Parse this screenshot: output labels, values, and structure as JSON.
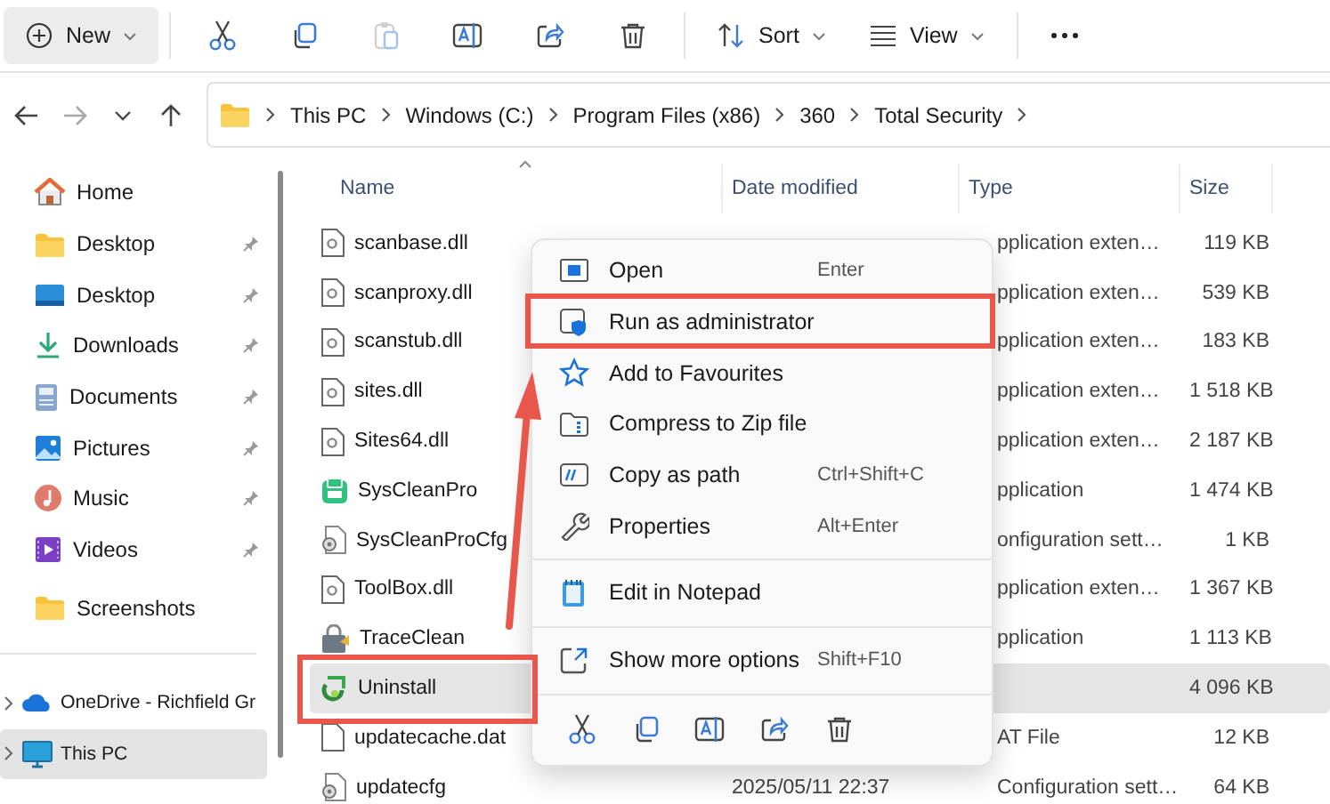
{
  "toolbar": {
    "groups": [
      [
        {
          "kind": "new",
          "label": "New",
          "selected": true,
          "disabled": false
        }
      ],
      [
        {
          "kind": "cut",
          "selected": false,
          "disabled": false
        },
        {
          "kind": "copy",
          "selected": false,
          "disabled": false
        },
        {
          "kind": "paste",
          "selected": false,
          "disabled": true
        },
        {
          "kind": "rename",
          "selected": false,
          "disabled": false
        },
        {
          "kind": "share",
          "selected": false,
          "disabled": false
        },
        {
          "kind": "delete",
          "selected": false,
          "disabled": false
        }
      ],
      [
        {
          "kind": "sort",
          "label": "Sort",
          "selected": false,
          "disabled": false
        },
        {
          "kind": "view",
          "label": "View",
          "selected": false,
          "disabled": false
        }
      ],
      [
        {
          "kind": "more",
          "selected": false,
          "disabled": false
        }
      ]
    ]
  },
  "navigation": {
    "forward_disabled": true
  },
  "address_bar": {
    "path": [
      "This PC",
      "Windows (C:)",
      "Program Files (x86)",
      "360",
      "Total Security"
    ]
  },
  "sidebar": {
    "items": [
      {
        "kind": "home",
        "label": "Home",
        "pinned": false
      },
      {
        "kind": "folder",
        "label": "Desktop",
        "pinned": true
      },
      {
        "kind": "desktop",
        "label": "Desktop",
        "pinned": true
      },
      {
        "kind": "downloads",
        "label": "Downloads",
        "pinned": true
      },
      {
        "kind": "documents",
        "label": "Documents",
        "pinned": true
      },
      {
        "kind": "pictures",
        "label": "Pictures",
        "pinned": true
      },
      {
        "kind": "music",
        "label": "Music",
        "pinned": true
      },
      {
        "kind": "videos",
        "label": "Videos",
        "pinned": true
      },
      {
        "kind": "folder",
        "label": "Screenshots",
        "pinned": false
      }
    ],
    "drives": [
      {
        "kind": "cloud",
        "label": "OneDrive - Richfield Gr",
        "expanded": false,
        "selected": false
      },
      {
        "kind": "pc",
        "label": "This PC",
        "expanded": false,
        "selected": true
      }
    ]
  },
  "file_list": {
    "columns": [
      "Name",
      "Date modified",
      "Type",
      "Size"
    ],
    "rows": [
      {
        "kind": "dll",
        "name": "scanbase.dll",
        "type": "pplication exten…",
        "size": "119 KB",
        "selected": false
      },
      {
        "kind": "dll",
        "name": "scanproxy.dll",
        "type": "pplication exten…",
        "size": "539 KB",
        "selected": false
      },
      {
        "kind": "dll",
        "name": "scanstub.dll",
        "type": "pplication exten…",
        "size": "183 KB",
        "selected": false
      },
      {
        "kind": "dll",
        "name": "sites.dll",
        "type": "pplication exten…",
        "size": "1 518 KB",
        "selected": false
      },
      {
        "kind": "dll",
        "name": "Sites64.dll",
        "type": "pplication exten…",
        "size": "2 187 KB",
        "selected": false
      },
      {
        "kind": "app",
        "name": "SysCleanPro",
        "type": "pplication",
        "size": "1 474 KB",
        "selected": false
      },
      {
        "kind": "config",
        "name": "SysCleanProCfg",
        "type": "onfiguration sett…",
        "size": "1 KB",
        "selected": false
      },
      {
        "kind": "dll",
        "name": "ToolBox.dll",
        "type": "pplication exten…",
        "size": "1 367 KB",
        "selected": false
      },
      {
        "kind": "tool",
        "name": "TraceClean",
        "type": "pplication",
        "size": "1 113 KB",
        "selected": false
      },
      {
        "kind": "installer",
        "name": "Uninstall",
        "size": "4 096 KB",
        "selected": true
      },
      {
        "kind": "file",
        "name": "updatecache.dat",
        "type": "AT File",
        "size": "12 KB",
        "selected": false
      },
      {
        "kind": "config",
        "name": "updatecfg",
        "date": "2025/05/11 22:37",
        "type": "Configuration sett…",
        "size": "64 KB",
        "selected": false
      }
    ]
  },
  "context_menu": {
    "groups": [
      [
        {
          "kind": "open",
          "label": "Open",
          "shortcut": "Enter"
        },
        {
          "kind": "admin",
          "label": "Run as administrator"
        },
        {
          "kind": "favourite",
          "label": "Add to Favourites"
        },
        {
          "kind": "zip",
          "label": "Compress to Zip file"
        },
        {
          "kind": "path",
          "label": "Copy as path",
          "shortcut": "Ctrl+Shift+C"
        },
        {
          "kind": "properties",
          "label": "Properties",
          "shortcut": "Alt+Enter"
        }
      ],
      [
        {
          "kind": "notepad",
          "label": "Edit in Notepad"
        }
      ],
      [
        {
          "kind": "more",
          "label": "Show more options",
          "shortcut": "Shift+F10"
        }
      ]
    ],
    "actions": [
      {
        "kind": "cut"
      },
      {
        "kind": "copy"
      },
      {
        "kind": "rename"
      },
      {
        "kind": "share"
      },
      {
        "kind": "delete"
      }
    ]
  }
}
